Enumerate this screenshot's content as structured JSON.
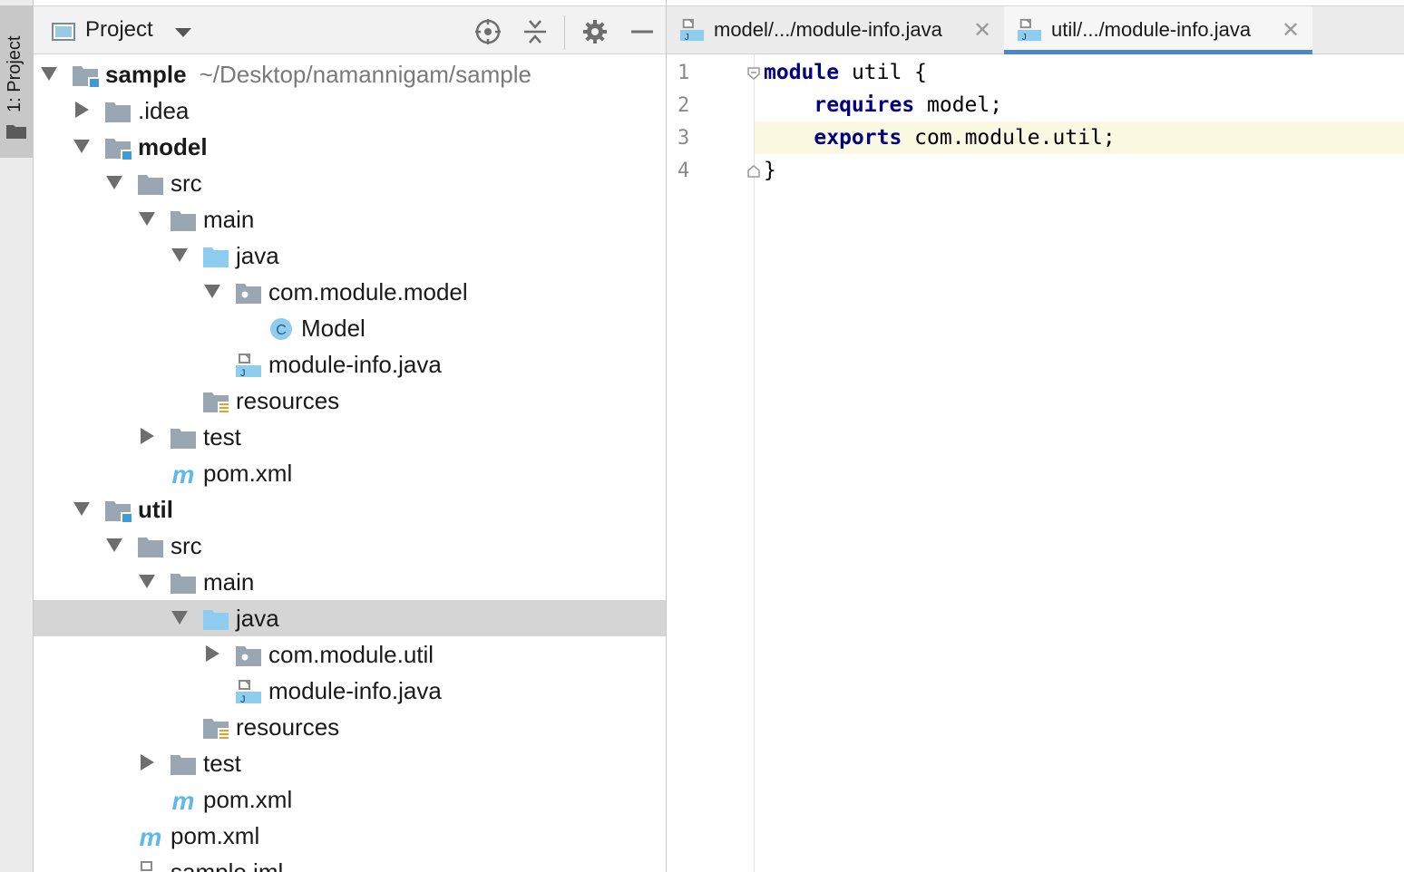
{
  "toolstrip": {
    "project_tab_label": "1: Project"
  },
  "panel": {
    "title": "Project",
    "buttons": [
      "locate-icon",
      "collapse-all-icon",
      "gear-icon",
      "minimize-icon"
    ]
  },
  "tree": [
    {
      "label": "sample",
      "extra": "~/Desktop/namannigam/sample",
      "bold": true,
      "icon": "module-folder-icon",
      "toggle": "down",
      "depth": 0
    },
    {
      "label": ".idea",
      "icon": "folder-icon",
      "toggle": "right",
      "depth": 1
    },
    {
      "label": "model",
      "bold": true,
      "icon": "module-folder-icon",
      "toggle": "down",
      "depth": 1
    },
    {
      "label": "src",
      "icon": "folder-icon",
      "toggle": "down",
      "depth": 2
    },
    {
      "label": "main",
      "icon": "folder-icon",
      "toggle": "down",
      "depth": 3
    },
    {
      "label": "java",
      "icon": "source-folder-icon",
      "toggle": "down",
      "depth": 4
    },
    {
      "label": "com.module.model",
      "icon": "package-icon",
      "toggle": "down",
      "depth": 5
    },
    {
      "label": "Model",
      "icon": "class-icon",
      "toggle": "none",
      "depth": 6
    },
    {
      "label": "module-info.java",
      "icon": "java-file-icon",
      "toggle": "none",
      "depth": 5
    },
    {
      "label": "resources",
      "icon": "resources-folder-icon",
      "toggle": "none",
      "depth": 4
    },
    {
      "label": "test",
      "icon": "folder-icon",
      "toggle": "right",
      "depth": 3
    },
    {
      "label": "pom.xml",
      "icon": "maven-icon",
      "toggle": "none",
      "depth": 3
    },
    {
      "label": "util",
      "bold": true,
      "icon": "module-folder-icon",
      "toggle": "down",
      "depth": 1
    },
    {
      "label": "src",
      "icon": "folder-icon",
      "toggle": "down",
      "depth": 2
    },
    {
      "label": "main",
      "icon": "folder-icon",
      "toggle": "down",
      "depth": 3
    },
    {
      "label": "java",
      "icon": "source-folder-icon",
      "toggle": "down",
      "depth": 4,
      "selected": true
    },
    {
      "label": "com.module.util",
      "icon": "package-icon",
      "toggle": "right",
      "depth": 5
    },
    {
      "label": "module-info.java",
      "icon": "java-file-icon",
      "toggle": "none",
      "depth": 5
    },
    {
      "label": "resources",
      "icon": "resources-folder-icon",
      "toggle": "none",
      "depth": 4
    },
    {
      "label": "test",
      "icon": "folder-icon",
      "toggle": "right",
      "depth": 3
    },
    {
      "label": "pom.xml",
      "icon": "maven-icon",
      "toggle": "none",
      "depth": 3
    },
    {
      "label": "pom.xml",
      "icon": "maven-icon",
      "toggle": "none",
      "depth": 2
    },
    {
      "label": "sample.iml",
      "icon": "iml-file-icon",
      "toggle": "none",
      "depth": 2
    }
  ],
  "tabs": [
    {
      "label": "model/.../module-info.java",
      "active": false
    },
    {
      "label": "util/.../module-info.java",
      "active": true
    }
  ],
  "editor": {
    "lines": [
      {
        "no": "1",
        "tokens": [
          {
            "t": "module",
            "kw": true
          },
          {
            "t": " util {",
            "kw": false
          }
        ]
      },
      {
        "no": "2",
        "tokens": [
          {
            "t": "    ",
            "kw": false
          },
          {
            "t": "requires",
            "kw": true
          },
          {
            "t": " model;",
            "kw": false
          }
        ]
      },
      {
        "no": "3",
        "tokens": [
          {
            "t": "    ",
            "kw": false
          },
          {
            "t": "exports",
            "kw": true
          },
          {
            "t": " com.module.util;",
            "kw": false
          }
        ],
        "current": true
      },
      {
        "no": "4",
        "tokens": [
          {
            "t": "}",
            "kw": false
          }
        ]
      }
    ]
  },
  "colors": {
    "selection": "#d5d5d5",
    "accent": "#4a88c7",
    "keyword": "#000080",
    "current_line": "#fcf9e3"
  }
}
